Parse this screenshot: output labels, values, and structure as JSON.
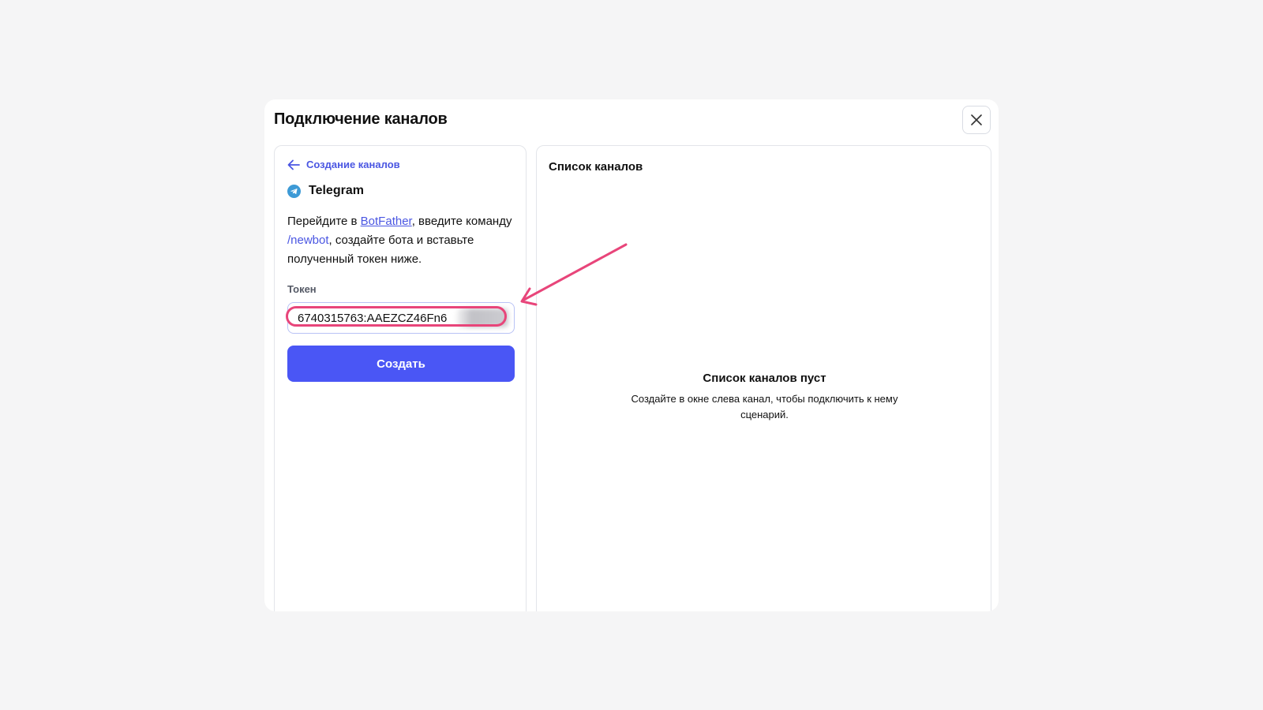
{
  "modal": {
    "title": "Подключение каналов",
    "close_icon": "close-icon"
  },
  "create_panel": {
    "back_label": "Создание каналов",
    "back_icon": "arrow-left-icon",
    "channel_name": "Telegram",
    "channel_icon": "telegram-icon",
    "instructions": {
      "part1": "Перейдите в ",
      "botfather_link": "BotFather",
      "part2": ", введите команду ",
      "command": "/newbot",
      "part3": ", создайте бота и вставьте полученный токен ниже."
    },
    "token_label": "Токен",
    "token_value": "6740315763:AAEZCZ46Fn6",
    "create_button": "Создать"
  },
  "list_panel": {
    "title": "Список каналов",
    "empty_title": "Список каналов пуст",
    "empty_description": "Создайте в окне слева канал, чтобы подключить к нему сценарий."
  },
  "colors": {
    "accent": "#4a56f5",
    "link": "#4a56e2",
    "annotation": "#e8457a",
    "telegram": "#3d9ad6"
  }
}
